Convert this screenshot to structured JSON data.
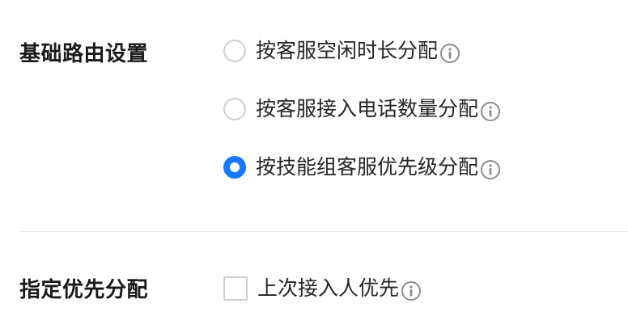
{
  "routing": {
    "label": "基础路由设置",
    "options": [
      {
        "label": "按客服空闲时长分配",
        "checked": false
      },
      {
        "label": "按客服接入电话数量分配",
        "checked": false
      },
      {
        "label": "按技能组客服优先级分配",
        "checked": true
      }
    ]
  },
  "priority": {
    "label": "指定优先分配",
    "options": [
      {
        "label": "上次接入人优先",
        "checked": false
      }
    ]
  },
  "colors": {
    "accent": "#1677ff",
    "border": "#cfcfcf",
    "divider": "#e6e6e6",
    "icon": "#8c8c8c"
  },
  "icons": {
    "info": "info-circle-icon"
  }
}
